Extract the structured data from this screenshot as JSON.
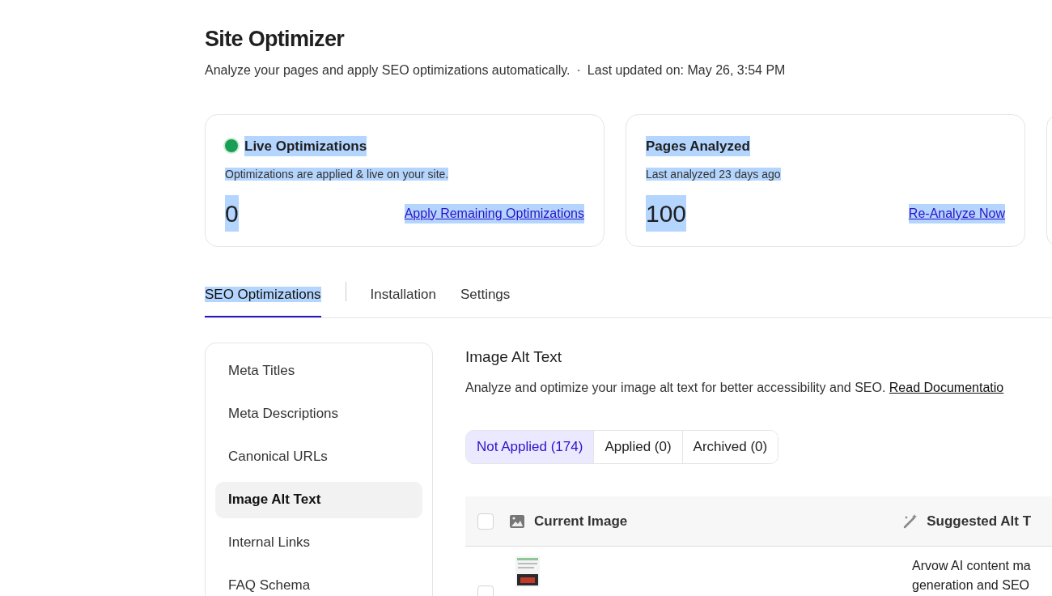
{
  "header": {
    "title": "Site Optimizer",
    "subtitle": "Analyze your pages and apply SEO optimizations automatically.",
    "separator": "·",
    "updated": "Last updated on: May 26, 3:54 PM"
  },
  "cards": [
    {
      "kind": "status",
      "title": "Live Optimizations",
      "description": "Optimizations are applied & live on your site.",
      "count": "0",
      "action": "Apply Remaining Optimizations",
      "highlighted": true
    },
    {
      "kind": "plain",
      "title": "Pages Analyzed",
      "description": "Last analyzed 23 days ago",
      "count": "100",
      "action": "Re-Analyze Now",
      "highlighted": true
    }
  ],
  "tabs": [
    {
      "label": "SEO Optimizations",
      "selected": true,
      "highlighted": true
    },
    {
      "label": "Installation",
      "selected": false,
      "highlighted": false
    },
    {
      "label": "Settings",
      "selected": false,
      "highlighted": false
    }
  ],
  "sidebar": {
    "items": [
      {
        "label": "Meta Titles",
        "selected": false
      },
      {
        "label": "Meta Descriptions",
        "selected": false
      },
      {
        "label": "Canonical URLs",
        "selected": false
      },
      {
        "label": "Image Alt Text",
        "selected": true
      },
      {
        "label": "Internal Links",
        "selected": false
      },
      {
        "label": "FAQ Schema",
        "selected": false
      }
    ]
  },
  "section": {
    "title": "Image Alt Text",
    "description": "Analyze and optimize your image alt text for better accessibility and SEO.",
    "link": "Read Documentatio"
  },
  "filters": [
    {
      "label": "Not Applied (174)",
      "selected": true
    },
    {
      "label": "Applied (0)",
      "selected": false
    },
    {
      "label": "Archived (0)",
      "selected": false
    }
  ],
  "table": {
    "select_all": {
      "checked": false
    },
    "columns": [
      "Current Image",
      "Suggested Alt T"
    ],
    "rows": [
      {
        "checked": false,
        "image": {
          "kind": "picture"
        },
        "suggested": [
          "Arvow AI content ma",
          "generation and SEO"
        ]
      }
    ]
  }
}
